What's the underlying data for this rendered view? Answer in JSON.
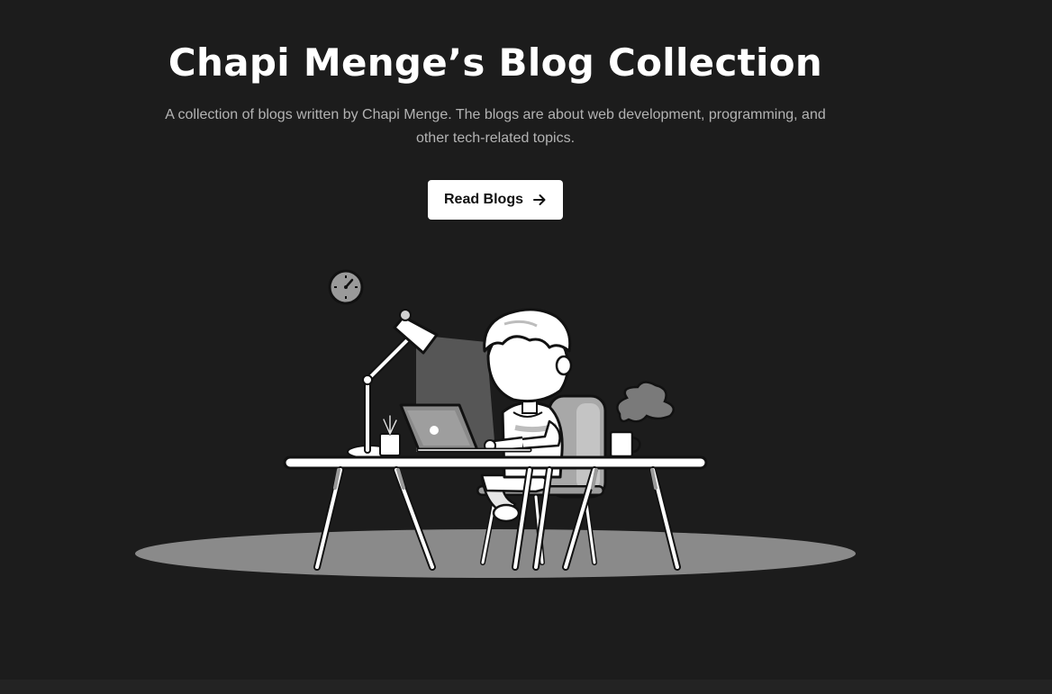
{
  "hero": {
    "title": "Chapi Menge’s Blog Collection",
    "subtitle": "A collection of blogs written by Chapi Menge. The blogs are about web development, programming, and other tech-related topics.",
    "cta_label": "Read Blogs",
    "cta_icon": "arrow-right-icon"
  },
  "colors": {
    "background": "#1c1c1c",
    "title": "#ffffff",
    "subtitle": "#b3b3b3",
    "button_bg": "#ffffff",
    "button_text": "#111111"
  }
}
